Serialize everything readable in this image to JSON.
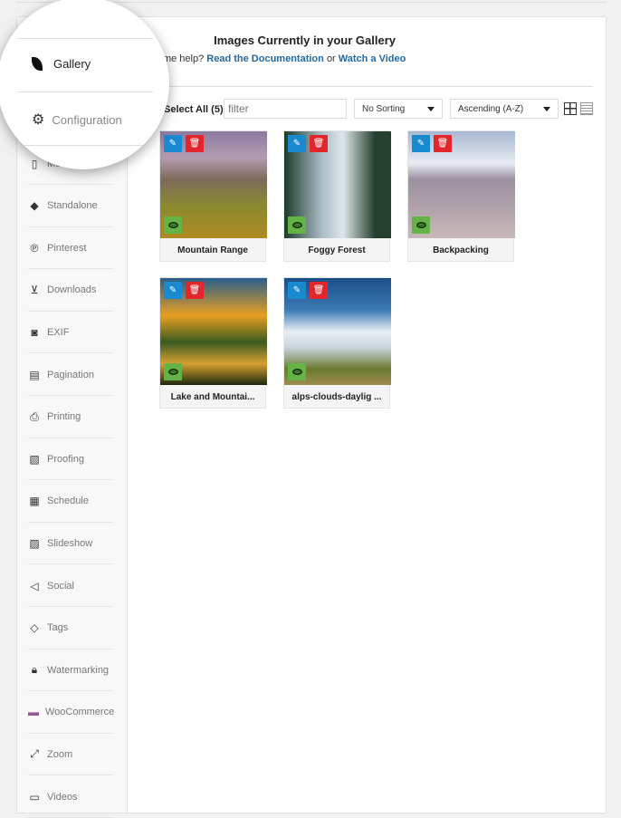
{
  "sidebar": {
    "items": [
      {
        "label": "Mobile",
        "icon": "mobile-icon"
      },
      {
        "label": "Standalone",
        "icon": "standalone-icon"
      },
      {
        "label": "Pinterest",
        "icon": "pinterest-icon"
      },
      {
        "label": "Downloads",
        "icon": "download-icon"
      },
      {
        "label": "EXIF",
        "icon": "camera-icon"
      },
      {
        "label": "Pagination",
        "icon": "pagination-icon"
      },
      {
        "label": "Printing",
        "icon": "printer-icon"
      },
      {
        "label": "Proofing",
        "icon": "proofing-icon"
      },
      {
        "label": "Schedule",
        "icon": "calendar-icon"
      },
      {
        "label": "Slideshow",
        "icon": "slideshow-icon"
      },
      {
        "label": "Social",
        "icon": "megaphone-icon"
      },
      {
        "label": "Tags",
        "icon": "tag-icon"
      },
      {
        "label": "Watermarking",
        "icon": "lock-icon"
      },
      {
        "label": "WooCommerce",
        "icon": "woocommerce-icon"
      },
      {
        "label": "Zoom",
        "icon": "zoom-icon"
      },
      {
        "label": "Videos",
        "icon": "video-icon"
      }
    ]
  },
  "magnifier": {
    "gallery": "Gallery",
    "configuration": "Configuration"
  },
  "main": {
    "title": "Images Currently in your Gallery",
    "help_prefix": "Need some help?",
    "doc_link": "Read the Documentation",
    "or": "or",
    "video_link": "Watch a Video",
    "select_all": "Select All (5)",
    "filter_placeholder": "filter",
    "sorting": "No Sorting",
    "order": "Ascending (A-Z)"
  },
  "images": [
    {
      "title": "Mountain Range"
    },
    {
      "title": "Foggy Forest"
    },
    {
      "title": "Backpacking"
    },
    {
      "title": "Lake and Mountai..."
    },
    {
      "title": "alps-clouds-daylig ..."
    }
  ],
  "colors": {
    "edit": "#1a8ad0",
    "delete": "#e3262b",
    "view": "#64b346",
    "link": "#1f6aa5"
  }
}
